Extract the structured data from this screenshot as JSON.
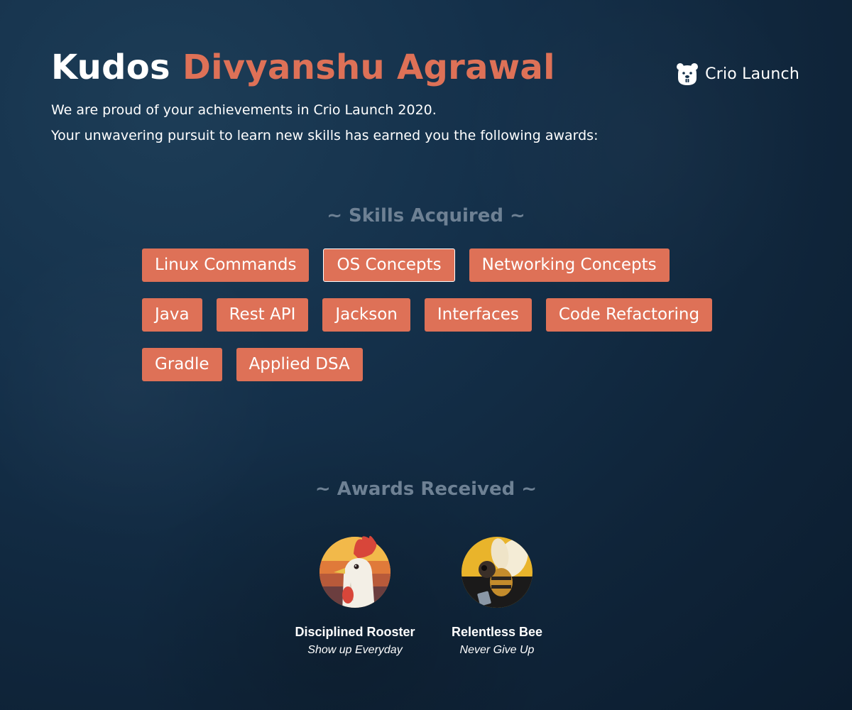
{
  "header": {
    "greeting": "Kudos",
    "name": "Divyanshu Agrawal",
    "intro_line1": "We are proud of your achievements in Crio Launch 2020.",
    "intro_line2": "Your unwavering pursuit to learn new skills has earned you the following awards:"
  },
  "brand": {
    "text": "Crio Launch",
    "icon": "beaver-logo-icon"
  },
  "skills": {
    "heading": "~ Skills Acquired ~",
    "items": [
      "Linux Commands",
      "OS Concepts",
      "Networking Concepts",
      "Java",
      "Rest API",
      "Jackson",
      "Interfaces",
      "Code Refactoring",
      "Gradle",
      "Applied DSA"
    ]
  },
  "awards": {
    "heading": "~ Awards Received ~",
    "items": [
      {
        "name": "Disciplined Rooster",
        "tagline": "Show up Everyday",
        "icon": "rooster-badge-icon"
      },
      {
        "name": "Relentless Bee",
        "tagline": "Never Give Up",
        "icon": "bee-badge-icon"
      }
    ]
  },
  "colors": {
    "accent": "#de7157",
    "background": "#14304a",
    "heading_muted": "#6e8194",
    "text": "#ffffff"
  }
}
